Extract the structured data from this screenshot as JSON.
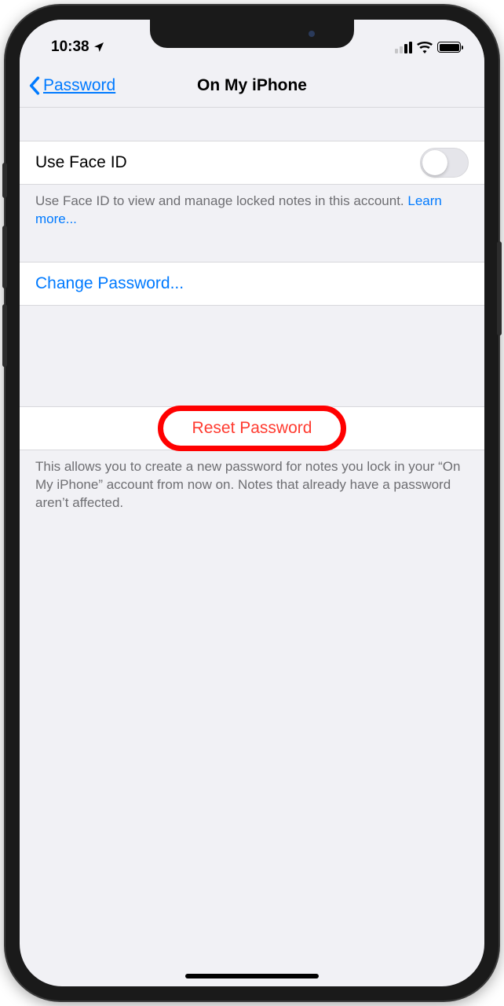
{
  "status": {
    "time": "10:38"
  },
  "nav": {
    "back_label": "Password",
    "title": "On My iPhone"
  },
  "faceid": {
    "label": "Use Face ID",
    "footer_pre": "Use Face ID to view and manage locked notes in this account. ",
    "footer_link": "Learn more..."
  },
  "change": {
    "label": "Change Password..."
  },
  "reset": {
    "label": "Reset Password",
    "footer": "This allows you to create a new password for notes you lock in your “On My iPhone” account from now on. Notes that already have a password aren’t affected."
  }
}
